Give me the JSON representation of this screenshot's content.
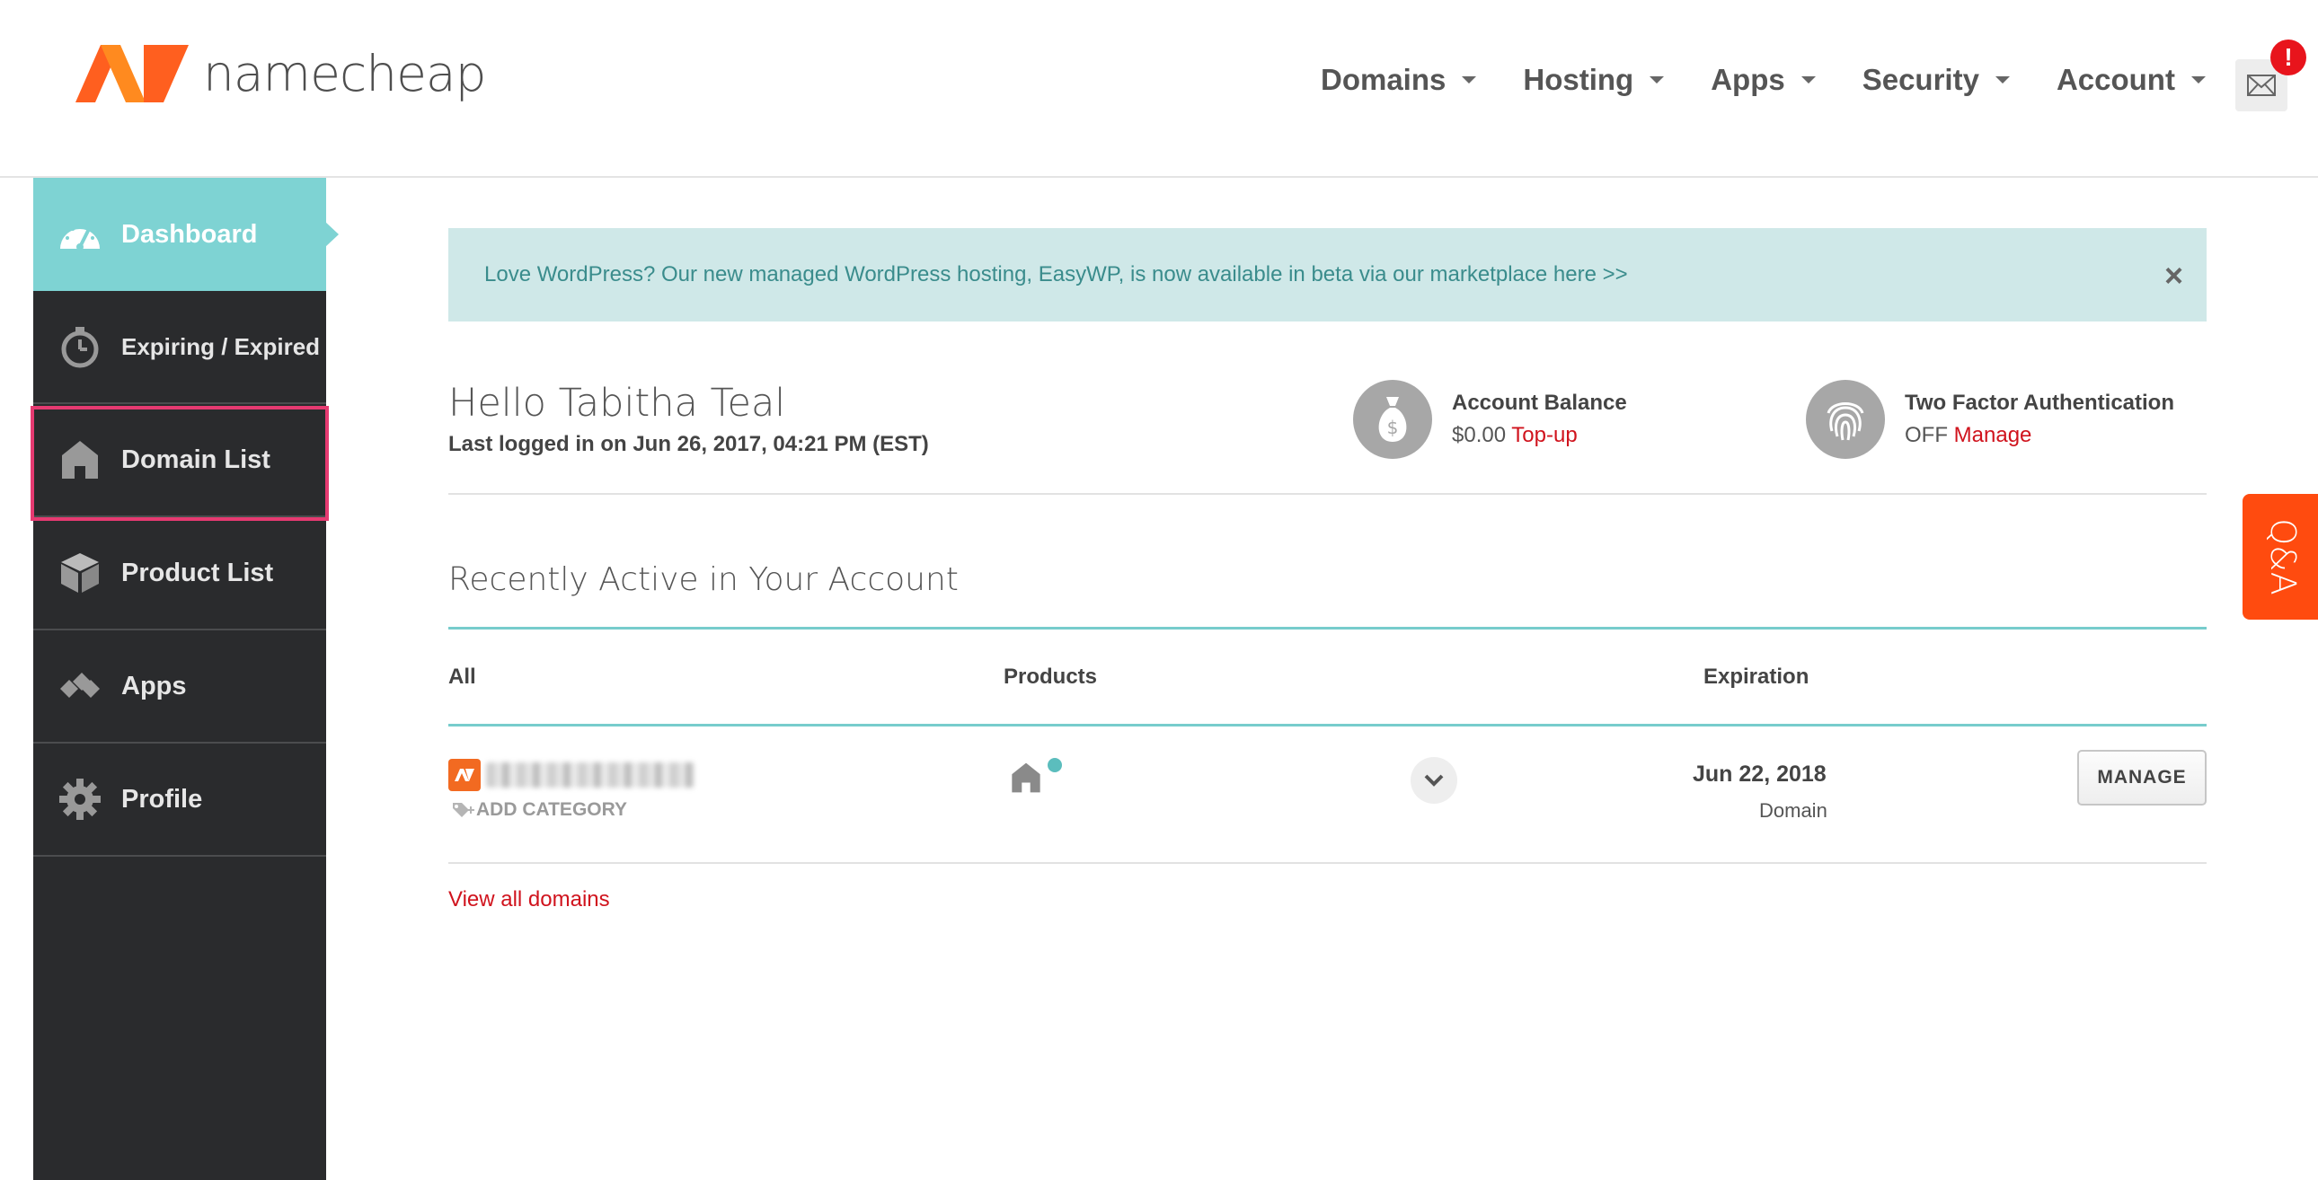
{
  "brand": {
    "name": "namecheap",
    "accent": "#ff5f1f",
    "teal": "#7ed3d3",
    "link_red": "#d0131d"
  },
  "nav": {
    "items": [
      "Domains",
      "Hosting",
      "Apps",
      "Security",
      "Account"
    ],
    "notification_badge": "!"
  },
  "sidebar": {
    "items": [
      {
        "label": "Dashboard",
        "icon": "speedometer-icon"
      },
      {
        "label": "Expiring / Expired",
        "icon": "stopwatch-icon"
      },
      {
        "label": "Domain List",
        "icon": "house-icon"
      },
      {
        "label": "Product List",
        "icon": "box-icon"
      },
      {
        "label": "Apps",
        "icon": "diamonds-icon"
      },
      {
        "label": "Profile",
        "icon": "gear-icon"
      }
    ]
  },
  "banner": {
    "text": "Love WordPress? Our new managed WordPress hosting, EasyWP, is now available in beta via our marketplace here >>",
    "close": "×"
  },
  "greeting": {
    "hello": "Hello Tabitha Teal",
    "last_login": "Last logged in on Jun 26, 2017, 04:21 PM (EST)"
  },
  "stats": {
    "balance": {
      "title": "Account Balance",
      "value": "$0.00",
      "link": "Top-up"
    },
    "two_factor": {
      "title": "Two Factor Authentication",
      "value": "OFF",
      "link": "Manage"
    }
  },
  "recent": {
    "title": "Recently Active in Your Account",
    "columns": [
      "All",
      "Products",
      "Expiration"
    ],
    "row": {
      "add_category": "ADD CATEGORY",
      "expiration_date": "Jun 22, 2018",
      "expiration_type": "Domain",
      "manage_label": "MANAGE"
    },
    "view_all": "View all domains"
  },
  "qa_tab": "Q&A"
}
